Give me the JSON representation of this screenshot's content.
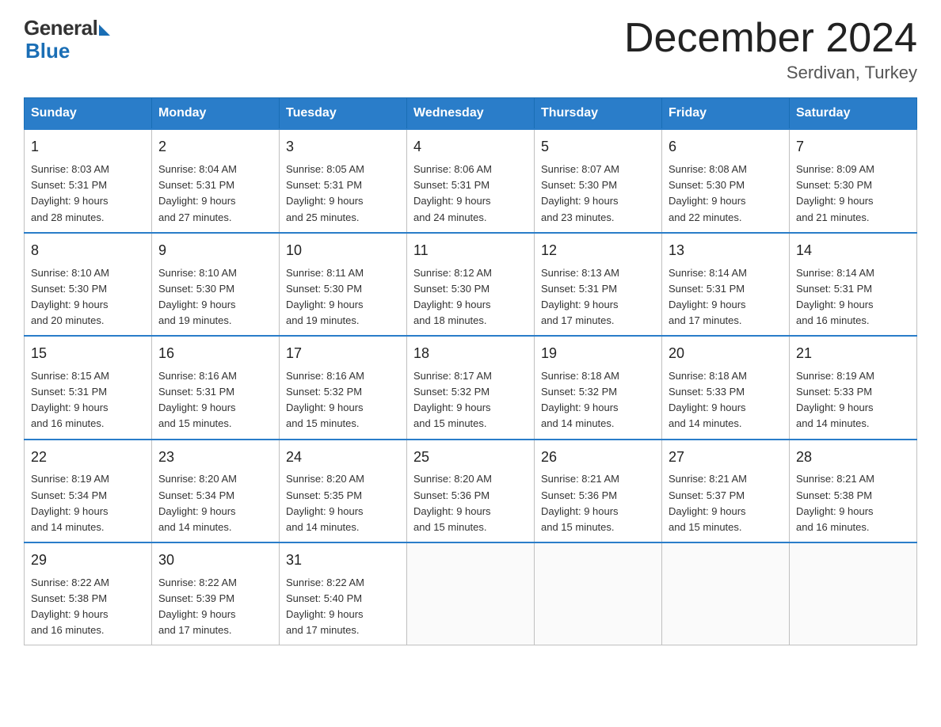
{
  "logo": {
    "general": "General",
    "blue": "Blue"
  },
  "title": "December 2024",
  "subtitle": "Serdivan, Turkey",
  "days_header": [
    "Sunday",
    "Monday",
    "Tuesday",
    "Wednesday",
    "Thursday",
    "Friday",
    "Saturday"
  ],
  "weeks": [
    [
      {
        "day": "1",
        "sunrise": "8:03 AM",
        "sunset": "5:31 PM",
        "daylight": "9 hours and 28 minutes."
      },
      {
        "day": "2",
        "sunrise": "8:04 AM",
        "sunset": "5:31 PM",
        "daylight": "9 hours and 27 minutes."
      },
      {
        "day": "3",
        "sunrise": "8:05 AM",
        "sunset": "5:31 PM",
        "daylight": "9 hours and 25 minutes."
      },
      {
        "day": "4",
        "sunrise": "8:06 AM",
        "sunset": "5:31 PM",
        "daylight": "9 hours and 24 minutes."
      },
      {
        "day": "5",
        "sunrise": "8:07 AM",
        "sunset": "5:30 PM",
        "daylight": "9 hours and 23 minutes."
      },
      {
        "day": "6",
        "sunrise": "8:08 AM",
        "sunset": "5:30 PM",
        "daylight": "9 hours and 22 minutes."
      },
      {
        "day": "7",
        "sunrise": "8:09 AM",
        "sunset": "5:30 PM",
        "daylight": "9 hours and 21 minutes."
      }
    ],
    [
      {
        "day": "8",
        "sunrise": "8:10 AM",
        "sunset": "5:30 PM",
        "daylight": "9 hours and 20 minutes."
      },
      {
        "day": "9",
        "sunrise": "8:10 AM",
        "sunset": "5:30 PM",
        "daylight": "9 hours and 19 minutes."
      },
      {
        "day": "10",
        "sunrise": "8:11 AM",
        "sunset": "5:30 PM",
        "daylight": "9 hours and 19 minutes."
      },
      {
        "day": "11",
        "sunrise": "8:12 AM",
        "sunset": "5:30 PM",
        "daylight": "9 hours and 18 minutes."
      },
      {
        "day": "12",
        "sunrise": "8:13 AM",
        "sunset": "5:31 PM",
        "daylight": "9 hours and 17 minutes."
      },
      {
        "day": "13",
        "sunrise": "8:14 AM",
        "sunset": "5:31 PM",
        "daylight": "9 hours and 17 minutes."
      },
      {
        "day": "14",
        "sunrise": "8:14 AM",
        "sunset": "5:31 PM",
        "daylight": "9 hours and 16 minutes."
      }
    ],
    [
      {
        "day": "15",
        "sunrise": "8:15 AM",
        "sunset": "5:31 PM",
        "daylight": "9 hours and 16 minutes."
      },
      {
        "day": "16",
        "sunrise": "8:16 AM",
        "sunset": "5:31 PM",
        "daylight": "9 hours and 15 minutes."
      },
      {
        "day": "17",
        "sunrise": "8:16 AM",
        "sunset": "5:32 PM",
        "daylight": "9 hours and 15 minutes."
      },
      {
        "day": "18",
        "sunrise": "8:17 AM",
        "sunset": "5:32 PM",
        "daylight": "9 hours and 15 minutes."
      },
      {
        "day": "19",
        "sunrise": "8:18 AM",
        "sunset": "5:32 PM",
        "daylight": "9 hours and 14 minutes."
      },
      {
        "day": "20",
        "sunrise": "8:18 AM",
        "sunset": "5:33 PM",
        "daylight": "9 hours and 14 minutes."
      },
      {
        "day": "21",
        "sunrise": "8:19 AM",
        "sunset": "5:33 PM",
        "daylight": "9 hours and 14 minutes."
      }
    ],
    [
      {
        "day": "22",
        "sunrise": "8:19 AM",
        "sunset": "5:34 PM",
        "daylight": "9 hours and 14 minutes."
      },
      {
        "day": "23",
        "sunrise": "8:20 AM",
        "sunset": "5:34 PM",
        "daylight": "9 hours and 14 minutes."
      },
      {
        "day": "24",
        "sunrise": "8:20 AM",
        "sunset": "5:35 PM",
        "daylight": "9 hours and 14 minutes."
      },
      {
        "day": "25",
        "sunrise": "8:20 AM",
        "sunset": "5:36 PM",
        "daylight": "9 hours and 15 minutes."
      },
      {
        "day": "26",
        "sunrise": "8:21 AM",
        "sunset": "5:36 PM",
        "daylight": "9 hours and 15 minutes."
      },
      {
        "day": "27",
        "sunrise": "8:21 AM",
        "sunset": "5:37 PM",
        "daylight": "9 hours and 15 minutes."
      },
      {
        "day": "28",
        "sunrise": "8:21 AM",
        "sunset": "5:38 PM",
        "daylight": "9 hours and 16 minutes."
      }
    ],
    [
      {
        "day": "29",
        "sunrise": "8:22 AM",
        "sunset": "5:38 PM",
        "daylight": "9 hours and 16 minutes."
      },
      {
        "day": "30",
        "sunrise": "8:22 AM",
        "sunset": "5:39 PM",
        "daylight": "9 hours and 17 minutes."
      },
      {
        "day": "31",
        "sunrise": "8:22 AM",
        "sunset": "5:40 PM",
        "daylight": "9 hours and 17 minutes."
      },
      null,
      null,
      null,
      null
    ]
  ],
  "labels": {
    "sunrise": "Sunrise:",
    "sunset": "Sunset:",
    "daylight": "Daylight:"
  }
}
